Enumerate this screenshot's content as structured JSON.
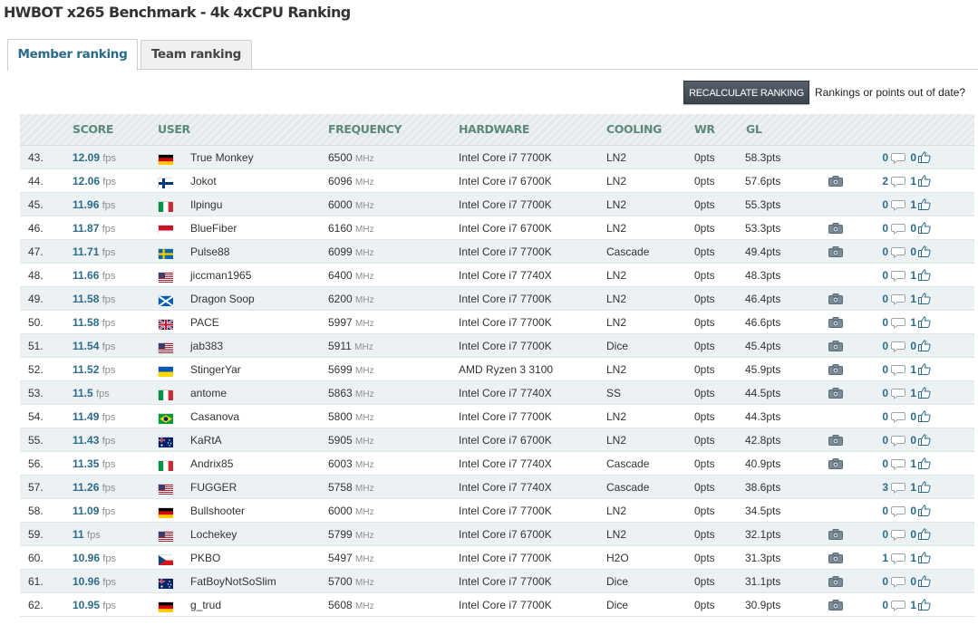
{
  "page": {
    "title": "HWBOT x265 Benchmark - 4k 4xCPU Ranking"
  },
  "tabs": [
    {
      "label": "Member ranking",
      "active": true
    },
    {
      "label": "Team ranking",
      "active": false
    }
  ],
  "actions": {
    "recalculate_label": "RECALCULATE RANKING",
    "note": "Rankings or points out of date?"
  },
  "table": {
    "headers": {
      "score": "SCORE",
      "user": "USER",
      "frequency": "FREQUENCY",
      "hardware": "HARDWARE",
      "cooling": "COOLING",
      "wr": "WR",
      "gl": "GL"
    },
    "score_unit": "fps",
    "freq_unit": "MHz",
    "rows": [
      {
        "rank": "43.",
        "score": "12.09",
        "flag": "germany",
        "user": "True Monkey",
        "frequency": "6500",
        "hardware": "Intel Core i7 7700K",
        "cooling": "LN2",
        "wr": "0pts",
        "gl": "58.3pts",
        "photo": false,
        "comments": "0",
        "likes": "0"
      },
      {
        "rank": "44.",
        "score": "12.06",
        "flag": "finland",
        "user": "Jokot",
        "frequency": "6096",
        "hardware": "Intel Core i7 6700K",
        "cooling": "LN2",
        "wr": "0pts",
        "gl": "57.6pts",
        "photo": true,
        "comments": "2",
        "likes": "1"
      },
      {
        "rank": "45.",
        "score": "11.96",
        "flag": "italy",
        "user": "Ilpingu",
        "frequency": "6000",
        "hardware": "Intel Core i7 7700K",
        "cooling": "LN2",
        "wr": "0pts",
        "gl": "55.3pts",
        "photo": false,
        "comments": "0",
        "likes": "1"
      },
      {
        "rank": "46.",
        "score": "11.87",
        "flag": "indonesia",
        "user": "BlueFiber",
        "frequency": "6160",
        "hardware": "Intel Core i7 6700K",
        "cooling": "LN2",
        "wr": "0pts",
        "gl": "53.3pts",
        "photo": true,
        "comments": "0",
        "likes": "0"
      },
      {
        "rank": "47.",
        "score": "11.71",
        "flag": "sweden",
        "user": "Pulse88",
        "frequency": "6099",
        "hardware": "Intel Core i7 7700K",
        "cooling": "Cascade",
        "wr": "0pts",
        "gl": "49.4pts",
        "photo": true,
        "comments": "0",
        "likes": "0"
      },
      {
        "rank": "48.",
        "score": "11.66",
        "flag": "usa",
        "user": "jiccman1965",
        "frequency": "6400",
        "hardware": "Intel Core i7 7740X",
        "cooling": "LN2",
        "wr": "0pts",
        "gl": "48.3pts",
        "photo": false,
        "comments": "0",
        "likes": "1"
      },
      {
        "rank": "49.",
        "score": "11.58",
        "flag": "scotland",
        "user": "Dragon Soop",
        "frequency": "6200",
        "hardware": "Intel Core i7 7700K",
        "cooling": "LN2",
        "wr": "0pts",
        "gl": "46.4pts",
        "photo": true,
        "comments": "0",
        "likes": "1"
      },
      {
        "rank": "50.",
        "score": "11.58",
        "flag": "uk",
        "user": "PACE",
        "frequency": "5997",
        "hardware": "Intel Core i7 7700K",
        "cooling": "LN2",
        "wr": "0pts",
        "gl": "46.6pts",
        "photo": true,
        "comments": "0",
        "likes": "1"
      },
      {
        "rank": "51.",
        "score": "11.54",
        "flag": "usa",
        "user": "jab383",
        "frequency": "5911",
        "hardware": "Intel Core i7 7700K",
        "cooling": "Dice",
        "wr": "0pts",
        "gl": "45.4pts",
        "photo": true,
        "comments": "0",
        "likes": "0"
      },
      {
        "rank": "52.",
        "score": "11.52",
        "flag": "ukraine",
        "user": "StingerYar",
        "frequency": "5699",
        "hardware": "AMD Ryzen 3 3100",
        "cooling": "LN2",
        "wr": "0pts",
        "gl": "45.9pts",
        "photo": true,
        "comments": "0",
        "likes": "1"
      },
      {
        "rank": "53.",
        "score": "11.5",
        "flag": "italy",
        "user": "antome",
        "frequency": "5863",
        "hardware": "Intel Core i7 7740X",
        "cooling": "SS",
        "wr": "0pts",
        "gl": "44.5pts",
        "photo": true,
        "comments": "0",
        "likes": "1"
      },
      {
        "rank": "54.",
        "score": "11.49",
        "flag": "brazil",
        "user": "Casanova",
        "frequency": "5800",
        "hardware": "Intel Core i7 7700K",
        "cooling": "LN2",
        "wr": "0pts",
        "gl": "44.3pts",
        "photo": false,
        "comments": "0",
        "likes": "0"
      },
      {
        "rank": "55.",
        "score": "11.43",
        "flag": "australia",
        "user": "KaRtA",
        "frequency": "5905",
        "hardware": "Intel Core i7 6700K",
        "cooling": "LN2",
        "wr": "0pts",
        "gl": "42.8pts",
        "photo": true,
        "comments": "0",
        "likes": "0"
      },
      {
        "rank": "56.",
        "score": "11.35",
        "flag": "italy",
        "user": "Andrix85",
        "frequency": "6003",
        "hardware": "Intel Core i7 7740X",
        "cooling": "Cascade",
        "wr": "0pts",
        "gl": "40.9pts",
        "photo": true,
        "comments": "0",
        "likes": "1"
      },
      {
        "rank": "57.",
        "score": "11.26",
        "flag": "usa",
        "user": "FUGGER",
        "frequency": "5758",
        "hardware": "Intel Core i7 7740X",
        "cooling": "Cascade",
        "wr": "0pts",
        "gl": "38.6pts",
        "photo": false,
        "comments": "3",
        "likes": "1"
      },
      {
        "rank": "58.",
        "score": "11.09",
        "flag": "germany",
        "user": "Bullshooter",
        "frequency": "6000",
        "hardware": "Intel Core i7 7700K",
        "cooling": "LN2",
        "wr": "0pts",
        "gl": "34.5pts",
        "photo": false,
        "comments": "0",
        "likes": "0"
      },
      {
        "rank": "59.",
        "score": "11",
        "flag": "usa",
        "user": "Lochekey",
        "frequency": "5799",
        "hardware": "Intel Core i7 6700K",
        "cooling": "LN2",
        "wr": "0pts",
        "gl": "32.1pts",
        "photo": true,
        "comments": "0",
        "likes": "0"
      },
      {
        "rank": "60.",
        "score": "10.96",
        "flag": "czech",
        "user": "PKBO",
        "frequency": "5497",
        "hardware": "Intel Core i7 7700K",
        "cooling": "H2O",
        "wr": "0pts",
        "gl": "31.3pts",
        "photo": true,
        "comments": "1",
        "likes": "1"
      },
      {
        "rank": "61.",
        "score": "10.96",
        "flag": "australia",
        "user": "FatBoyNotSoSlim",
        "frequency": "5700",
        "hardware": "Intel Core i7 7700K",
        "cooling": "Dice",
        "wr": "0pts",
        "gl": "31.1pts",
        "photo": true,
        "comments": "0",
        "likes": "0"
      },
      {
        "rank": "62.",
        "score": "10.95",
        "flag": "germany",
        "user": "g_trud",
        "frequency": "5608",
        "hardware": "Intel Core i7 7700K",
        "cooling": "Dice",
        "wr": "0pts",
        "gl": "30.9pts",
        "photo": true,
        "comments": "0",
        "likes": "1"
      }
    ]
  },
  "colors": {
    "accent": "#2b6c8a",
    "header_text": "#5d8a78",
    "row_alt": "#ecf1f4",
    "button": "#3b444d"
  }
}
